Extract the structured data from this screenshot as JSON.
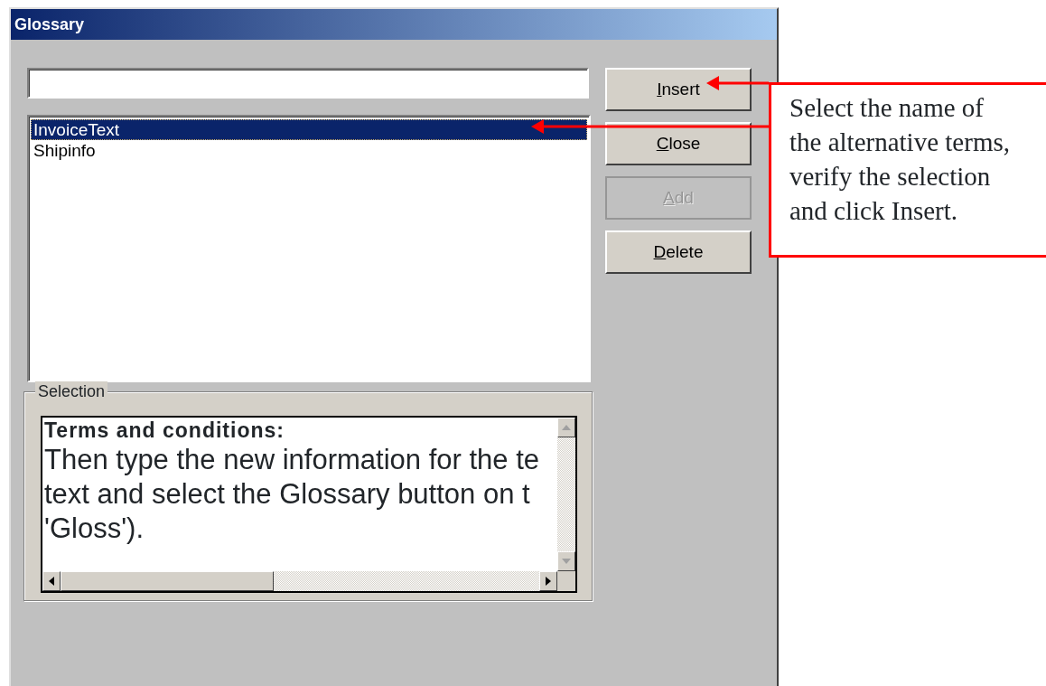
{
  "window": {
    "title": "Glossary"
  },
  "terms": [
    {
      "label": "InvoiceText",
      "selected": true
    },
    {
      "label": "Shipinfo",
      "selected": false
    }
  ],
  "buttons": [
    {
      "label": "Insert",
      "disabled": false
    },
    {
      "label": "Close",
      "disabled": false
    },
    {
      "label": "Add",
      "disabled": true
    },
    {
      "label": "Delete",
      "disabled": false
    }
  ],
  "selection": {
    "title": "Selection",
    "heading": "Terms and conditions:",
    "lines": [
      "Then type the new information for the te",
      "text and select the Glossary button on t",
      "'Gloss')."
    ]
  },
  "callout": {
    "lines": [
      "Select the name of",
      "the alternative terms,",
      "verify the selection",
      "and click Insert."
    ]
  }
}
